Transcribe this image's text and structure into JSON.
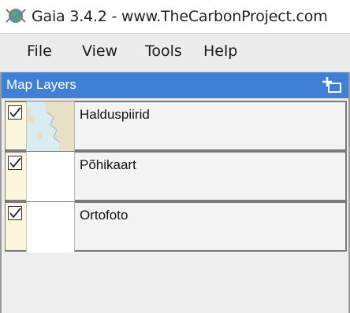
{
  "window": {
    "title": "Gaia 3.4.2 - www.TheCarbonProject.com",
    "app_icon": "gaia-globe-icon"
  },
  "menubar": {
    "items": [
      {
        "label": "File"
      },
      {
        "label": "View"
      },
      {
        "label": "Tools"
      },
      {
        "label": "Help"
      }
    ]
  },
  "map_layers": {
    "title": "Map Layers",
    "add_icon": "add-layer-icon",
    "layers": [
      {
        "name": "Halduspiirid",
        "checked": true,
        "thumbnail": "map-thumbnail"
      },
      {
        "name": "Põhikaart",
        "checked": true,
        "thumbnail": "blank-thumbnail"
      },
      {
        "name": "Ortofoto",
        "checked": true,
        "thumbnail": "blank-thumbnail"
      }
    ]
  },
  "colors": {
    "header_bg": "#3f7fd6",
    "menubar_bg": "#ececec",
    "row_strip": "#fbf7dc"
  }
}
